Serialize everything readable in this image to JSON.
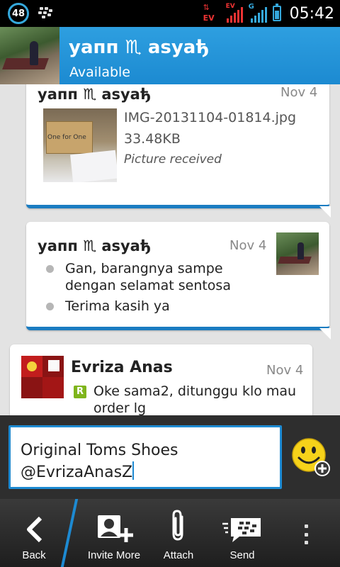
{
  "status_bar": {
    "notification_count": "48",
    "time": "05:42",
    "network_labels": [
      "EV",
      "EV",
      "G"
    ],
    "icons": [
      "bbm-icon",
      "ev-data-icon",
      "signal-icon",
      "signal-icon-2",
      "battery-charging-icon"
    ]
  },
  "header": {
    "name": "yaпп ♏ asyaђ",
    "status": "Available"
  },
  "messages": [
    {
      "sender": "yaпп ♏ asyaђ",
      "date": "Nov 4",
      "attachment": {
        "file_name": "IMG-20131104-01814.jpg",
        "file_size": "33.48KB",
        "status": "Picture received",
        "photo_text": "One for One"
      }
    },
    {
      "sender": "yaпп ♏ asyaђ",
      "date": "Nov 4",
      "lines": [
        "Gan, barangnya sampe dengan selamat sentosa",
        "Terima kasih ya"
      ]
    },
    {
      "sender": "Evriza Anas",
      "date": "Nov 4",
      "badge": "R",
      "text": "Oke sama2, ditunggu klo mau order lg"
    }
  ],
  "compose": {
    "text": "Original Toms Shoes\n@EvrizaAnasZ"
  },
  "bottom_bar": {
    "back": "Back",
    "invite": "Invite More",
    "attach": "Attach",
    "send": "Send"
  },
  "colors": {
    "accent": "#1d8ad2",
    "header": "#2196db",
    "chat_bg": "#e3e3e3",
    "read_badge": "#7fb51c"
  }
}
